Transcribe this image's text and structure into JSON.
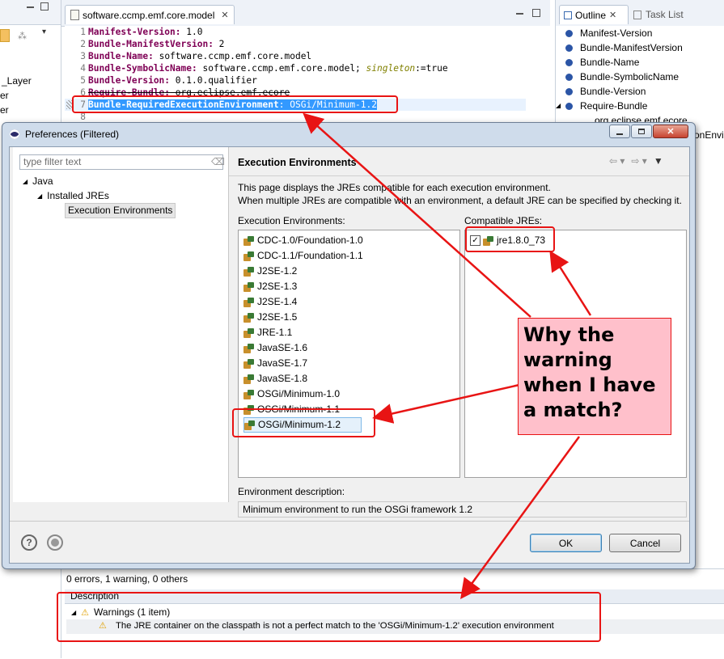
{
  "left_pane": {
    "items": [
      "_Layer",
      "er",
      "er"
    ]
  },
  "editor": {
    "tab_title": "software.ccmp.emf.core.model",
    "lines": [
      {
        "num": "1",
        "key": "Manifest-Version",
        "value": " 1.0",
        "style": "normal"
      },
      {
        "num": "2",
        "key": "Bundle-ManifestVersion",
        "value": " 2",
        "style": "normal"
      },
      {
        "num": "3",
        "key": "Bundle-Name",
        "value": " software.ccmp.emf.core.model",
        "style": "normal"
      },
      {
        "num": "4",
        "key": "Bundle-SymbolicName",
        "value": " software.ccmp.emf.core.model; ",
        "attr": "singleton",
        "attr_rest": ":=true",
        "style": "normal"
      },
      {
        "num": "5",
        "key": "Bundle-Version",
        "value": " 0.1.0.qualifier",
        "style": "normal"
      },
      {
        "num": "6",
        "key": "Require-Bundle",
        "value": " org.eclipse.emf.ecore",
        "style": "strike"
      },
      {
        "num": "7",
        "key": "Bundle-RequiredExecutionEnvironment",
        "value": " OSGi/Minimum-1.2",
        "style": "selected"
      },
      {
        "num": "8",
        "key": "",
        "value": "",
        "style": "normal"
      }
    ]
  },
  "outline": {
    "tab_outline": "Outline",
    "tab_tasks": "Task List",
    "items": [
      "Manifest-Version",
      "Bundle-ManifestVersion",
      "Bundle-Name",
      "Bundle-SymbolicName",
      "Bundle-Version",
      "Require-Bundle"
    ],
    "child": "org.eclipse.emf.ecore",
    "overflow_text": "onEnvi"
  },
  "dialog": {
    "title": "Preferences (Filtered)",
    "filter_placeholder": "type filter text",
    "tree": [
      "Java",
      "Installed JREs",
      "Execution Environments"
    ],
    "page_title": "Execution Environments",
    "intro_line1": "This page displays the JREs compatible for each execution environment.",
    "intro_line2": "When multiple JREs are compatible with an environment, a default JRE can be specified by checking it.",
    "env_label": "Execution Environments:",
    "jre_label": "Compatible JREs:",
    "environments": [
      "CDC-1.0/Foundation-1.0",
      "CDC-1.1/Foundation-1.1",
      "J2SE-1.2",
      "J2SE-1.3",
      "J2SE-1.4",
      "J2SE-1.5",
      "JRE-1.1",
      "JavaSE-1.6",
      "JavaSE-1.7",
      "JavaSE-1.8",
      "OSGi/Minimum-1.0",
      "OSGi/Minimum-1.1",
      "OSGi/Minimum-1.2"
    ],
    "selected_environment": "OSGi/Minimum-1.2",
    "jres": [
      {
        "name": "jre1.8.0_73",
        "checked": true
      }
    ],
    "desc_label": "Environment description:",
    "desc_value": "Minimum environment to run the OSGi framework 1.2",
    "ok": "OK",
    "cancel": "Cancel"
  },
  "problems": {
    "summary": "0 errors, 1 warning, 0 others",
    "column": "Description",
    "group": "Warnings (1 item)",
    "warning": "The JRE container on the classpath is not a perfect match to the 'OSGi/Minimum-1.2' execution environment"
  },
  "annotation": {
    "text": "Why the warning when I have a match?",
    "color": "#e81414",
    "fill": "#ffc0cb"
  }
}
